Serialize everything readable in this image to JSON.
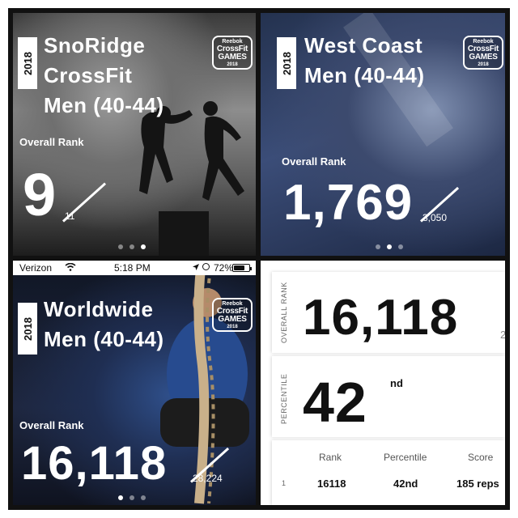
{
  "panels": {
    "snoridge": {
      "year": "2018",
      "title_lines": [
        "SnoRidge",
        "CrossFit",
        "Men (40-44)"
      ],
      "logo": {
        "brand": "Reebok",
        "line1": "CrossFit",
        "line2": "GAMES",
        "year": "2018"
      },
      "rank_label": "Overall Rank",
      "rank": "9",
      "total": "11",
      "pager": {
        "count": 3,
        "active": 2
      }
    },
    "westcoast": {
      "year": "2018",
      "title_lines": [
        "West Coast",
        "Men (40-44)"
      ],
      "logo": {
        "brand": "Reebok",
        "line1": "CrossFit",
        "line2": "GAMES",
        "year": "2018"
      },
      "rank_label": "Overall Rank",
      "rank": "1,769",
      "total": "3,050",
      "pager": {
        "count": 3,
        "active": 1
      }
    },
    "worldwide": {
      "status_bar": {
        "carrier": "Verizon",
        "time": "5:18 PM",
        "battery": "72%",
        "battery_level": 0.72
      },
      "year": "2018",
      "title_lines": [
        "Worldwide",
        "Men (40-44)"
      ],
      "logo": {
        "brand": "Reebok",
        "line1": "CrossFit",
        "line2": "GAMES",
        "year": "2018"
      },
      "rank_label": "Overall Rank",
      "rank": "16,118",
      "total": "28,224",
      "pager": {
        "count": 3,
        "active": 0
      }
    },
    "detail": {
      "overall_rank_label": "OVERALL RANK",
      "overall_rank": "16,118",
      "overall_rank_trail": "2",
      "percentile_label": "PERCENTILE",
      "percentile": "42",
      "percentile_suffix": "nd",
      "table": {
        "headers": [
          "Rank",
          "Percentile",
          "Score"
        ],
        "rows": [
          {
            "index": "1",
            "rank": "16118",
            "percentile": "42nd",
            "score": "185 reps"
          }
        ]
      }
    }
  }
}
